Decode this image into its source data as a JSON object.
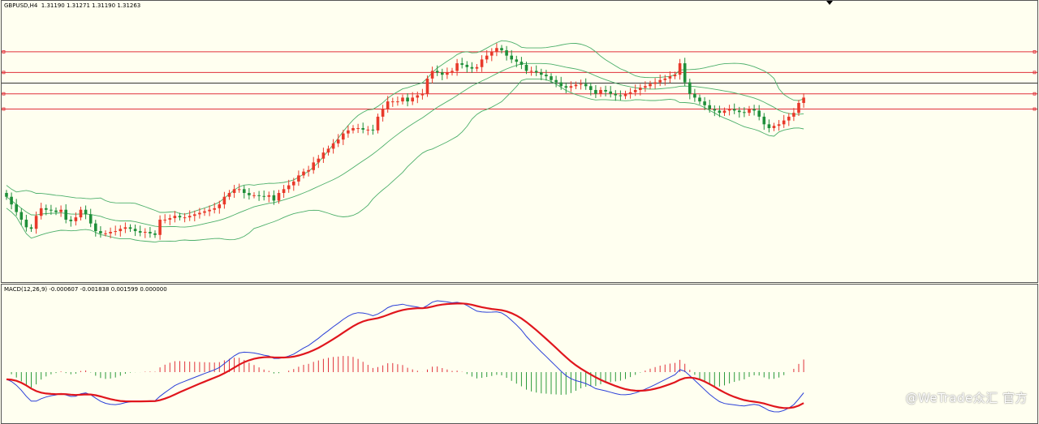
{
  "price_pane": {
    "label": "GBPUSD,H4  1.31190 1.31271 1.31190 1.31263"
  },
  "macd_pane": {
    "label": "MACD(12,26,9) -0.000607 -0.001838 0.001599 0.000000"
  },
  "watermark": "@WeTrade众汇 官方",
  "colors": {
    "background": "#fffff0",
    "bull_candle": "#e8392a",
    "bear_candle": "#1f8f3a",
    "bands": "#4caf6a",
    "level_lines": "#e0303a",
    "macd_line": "#2a3fd8",
    "signal_line": "#e0161d",
    "hist_positive": "#e0303a",
    "hist_negative": "#2a9a3a"
  },
  "chart_data": [
    {
      "type": "candlestick",
      "symbol": "GBPUSD",
      "timeframe": "H4",
      "last_bar": {
        "open": 1.3119,
        "high": 1.31271,
        "low": 1.3119,
        "close": 1.31263
      },
      "indicators": [
        "Bollinger Bands",
        "horizontal levels"
      ],
      "closes": [
        1.2935,
        1.2925,
        1.2915,
        1.2905,
        1.2895,
        1.2893,
        1.291,
        1.292,
        1.2918,
        1.2917,
        1.2915,
        1.2918,
        1.2905,
        1.2903,
        1.2908,
        1.2918,
        1.2912,
        1.29,
        1.289,
        1.2887,
        1.2887,
        1.2889,
        1.289,
        1.2893,
        1.2895,
        1.2893,
        1.289,
        1.2888,
        1.2889,
        1.2887,
        1.2885,
        1.2905,
        1.2905,
        1.2907,
        1.291,
        1.2908,
        1.2908,
        1.291,
        1.2912,
        1.2914,
        1.2916,
        1.2918,
        1.292,
        1.2925,
        1.2935,
        1.294,
        1.2945,
        1.2945,
        1.294,
        1.2937,
        1.2937,
        1.2936,
        1.2935,
        1.2937,
        1.293,
        1.294,
        1.2945,
        1.295,
        1.2955,
        1.2963,
        1.2968,
        1.297,
        1.298,
        1.2985,
        1.2993,
        1.2998,
        1.3005,
        1.301,
        1.3018,
        1.3022,
        1.3025,
        1.3025,
        1.3023,
        1.3023,
        1.3022,
        1.304,
        1.305,
        1.306,
        1.306,
        1.306,
        1.3065,
        1.306,
        1.3065,
        1.3068,
        1.307,
        1.309,
        1.31,
        1.3098,
        1.3095,
        1.3098,
        1.31,
        1.311,
        1.3108,
        1.3105,
        1.3103,
        1.3105,
        1.3115,
        1.312,
        1.3125,
        1.313,
        1.3127,
        1.312,
        1.3115,
        1.3112,
        1.3108,
        1.31,
        1.31,
        1.3098,
        1.3095,
        1.3093,
        1.3088,
        1.3085,
        1.308,
        1.3078,
        1.308,
        1.3082,
        1.3083,
        1.308,
        1.3075,
        1.307,
        1.3075,
        1.3073,
        1.307,
        1.3068,
        1.3067,
        1.307,
        1.3072,
        1.3075,
        1.3078,
        1.308,
        1.3083,
        1.3085,
        1.3088,
        1.309,
        1.3093,
        1.3095,
        1.311,
        1.3085,
        1.307,
        1.3065,
        1.306,
        1.3055,
        1.305,
        1.3048,
        1.3045,
        1.3048,
        1.305,
        1.3048,
        1.3046,
        1.3045,
        1.305,
        1.3048,
        1.304,
        1.303,
        1.3025,
        1.3028,
        1.303,
        1.3035,
        1.304,
        1.3045,
        1.3058,
        1.3065
      ]
    },
    {
      "type": "line",
      "name": "MACD(12,26,9)",
      "values_shown": {
        "main": -0.000607,
        "signal": -0.001838,
        "osma": 0.001599,
        "zero": 0.0
      }
    }
  ]
}
